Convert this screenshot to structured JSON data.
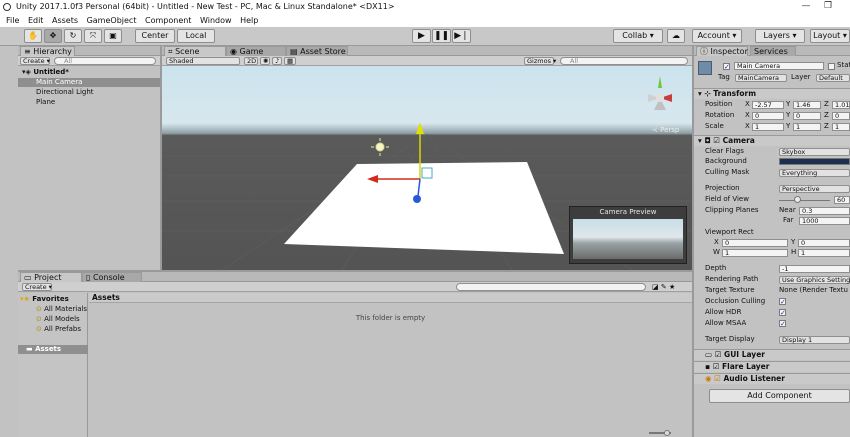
{
  "window": {
    "title": "Unity 2017.1.0f3 Personal (64bit) - Untitled - New Test - PC, Mac & Linux Standalone* <DX11>",
    "minimize": "—",
    "maximize": "❐"
  },
  "menu": [
    "File",
    "Edit",
    "Assets",
    "GameObject",
    "Component",
    "Window",
    "Help"
  ],
  "toolbar": {
    "pivot": "Center",
    "space": "Local",
    "collab": "Collab ▾",
    "account": "Account ▾",
    "layers": "Layers ▾",
    "layout": "Layout ▾"
  },
  "hierarchy": {
    "tab": "Hierarchy",
    "create": "Create ▾",
    "search_placeholder": "All",
    "scene": "Untitled*",
    "items": [
      "Main Camera",
      "Directional Light",
      "Plane"
    ]
  },
  "scene_view": {
    "tabs": [
      "Scene",
      "Game",
      "Asset Store"
    ],
    "shading": "Shaded",
    "mode_2d": "2D",
    "gizmos": "Gizmos ▾",
    "search_placeholder": "All",
    "persp_label": "Persp",
    "camera_preview_title": "Camera Preview"
  },
  "project": {
    "tabs": [
      "Project",
      "Console"
    ],
    "create": "Create ▾",
    "favorites_label": "Favorites",
    "favorites": [
      "All Materials",
      "All Models",
      "All Prefabs"
    ],
    "assets_tree_label": "Assets",
    "assets_header": "Assets",
    "empty_message": "This folder is empty"
  },
  "inspector": {
    "tabs": [
      "Inspector",
      "Services"
    ],
    "object_name": "Main Camera",
    "static_label": "Stati",
    "tag_label": "Tag",
    "tag_value": "MainCamera",
    "layer_label": "Layer",
    "layer_value": "Default",
    "transform": {
      "title": "Transform",
      "rows": [
        {
          "label": "Position",
          "x": "-2.57",
          "y": "1.46",
          "z": "1.01"
        },
        {
          "label": "Rotation",
          "x": "0",
          "y": "0",
          "z": "0"
        },
        {
          "label": "Scale",
          "x": "1",
          "y": "1",
          "z": "1"
        }
      ]
    },
    "camera": {
      "title": "Camera",
      "clear_flags_label": "Clear Flags",
      "clear_flags": "Skybox",
      "background_label": "Background",
      "background_color": "#1e2f4f",
      "culling_mask_label": "Culling Mask",
      "culling_mask": "Everything",
      "projection_label": "Projection",
      "projection": "Perspective",
      "fov_label": "Field of View",
      "fov": "60",
      "clipping_label": "Clipping Planes",
      "near_label": "Near",
      "near": "0.3",
      "far_label": "Far",
      "far": "1000",
      "viewport_label": "Viewport Rect",
      "vx": "0",
      "vy": "0",
      "vw": "1",
      "vh": "1",
      "depth_label": "Depth",
      "depth": "-1",
      "rendering_path_label": "Rendering Path",
      "rendering_path": "Use Graphics Setting",
      "target_texture_label": "Target Texture",
      "target_texture": "None (Render Textu",
      "occlusion_label": "Occlusion Culling",
      "hdr_label": "Allow HDR",
      "msaa_label": "Allow MSAA",
      "target_display_label": "Target Display",
      "target_display": "Display 1"
    },
    "components": [
      "GUI Layer",
      "Flare Layer",
      "Audio Listener"
    ],
    "add_component": "Add Component"
  },
  "colors": {
    "sky_top": "#cbe3ee",
    "sky_horizon": "#8ea0a6",
    "ground": "#545454",
    "y_axis": "#d8d800",
    "x_axis": "#d32a1a",
    "z_axis": "#2a58d8"
  }
}
